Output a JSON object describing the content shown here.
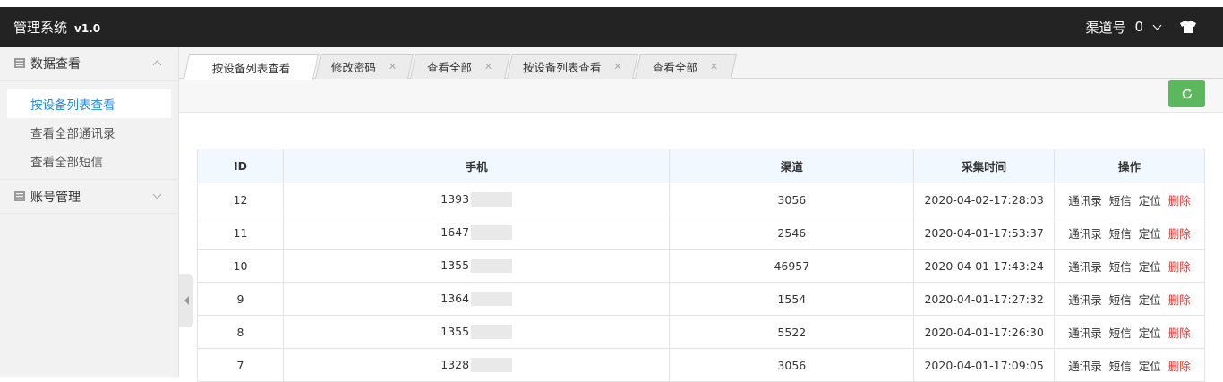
{
  "header": {
    "title": "管理系统",
    "version": "v1.0",
    "channel_label": "渠道号",
    "channel_value": "0"
  },
  "sidebar": {
    "groups": [
      {
        "label": "数据查看",
        "items": [
          {
            "label": "按设备列表查看",
            "active": true
          },
          {
            "label": "查看全部通讯录"
          },
          {
            "label": "查看全部短信"
          }
        ]
      },
      {
        "label": "账号管理"
      }
    ]
  },
  "tabs": [
    {
      "label": "按设备列表查看",
      "active": true
    },
    {
      "label": "修改密码"
    },
    {
      "label": "查看全部"
    },
    {
      "label": "按设备列表查看"
    },
    {
      "label": "查看全部"
    }
  ],
  "table": {
    "columns": [
      "ID",
      "手机",
      "渠道",
      "采集时间",
      "操作"
    ],
    "actions": [
      "通讯录",
      "短信",
      "定位",
      "删除"
    ],
    "rows": [
      {
        "id": "12",
        "phone": "1393",
        "channel": "3056",
        "time": "2020-04-02-17:28:03"
      },
      {
        "id": "11",
        "phone": "1647",
        "channel": "2546",
        "time": "2020-04-01-17:53:37"
      },
      {
        "id": "10",
        "phone": "1355",
        "channel": "46957",
        "time": "2020-04-01-17:43:24"
      },
      {
        "id": "9",
        "phone": "1364",
        "channel": "1554",
        "time": "2020-04-01-17:27:32"
      },
      {
        "id": "8",
        "phone": "1355",
        "channel": "5522",
        "time": "2020-04-01-17:26:30"
      },
      {
        "id": "7",
        "phone": "1328",
        "channel": "3056",
        "time": "2020-04-01-17:09:05"
      }
    ]
  },
  "colors": {
    "header_bg": "#232323",
    "active_link": "#1e88e5",
    "refresh_button": "#5cb85c",
    "delete_action": "#e5342f",
    "table_head_bg": "#f1f8ff"
  }
}
